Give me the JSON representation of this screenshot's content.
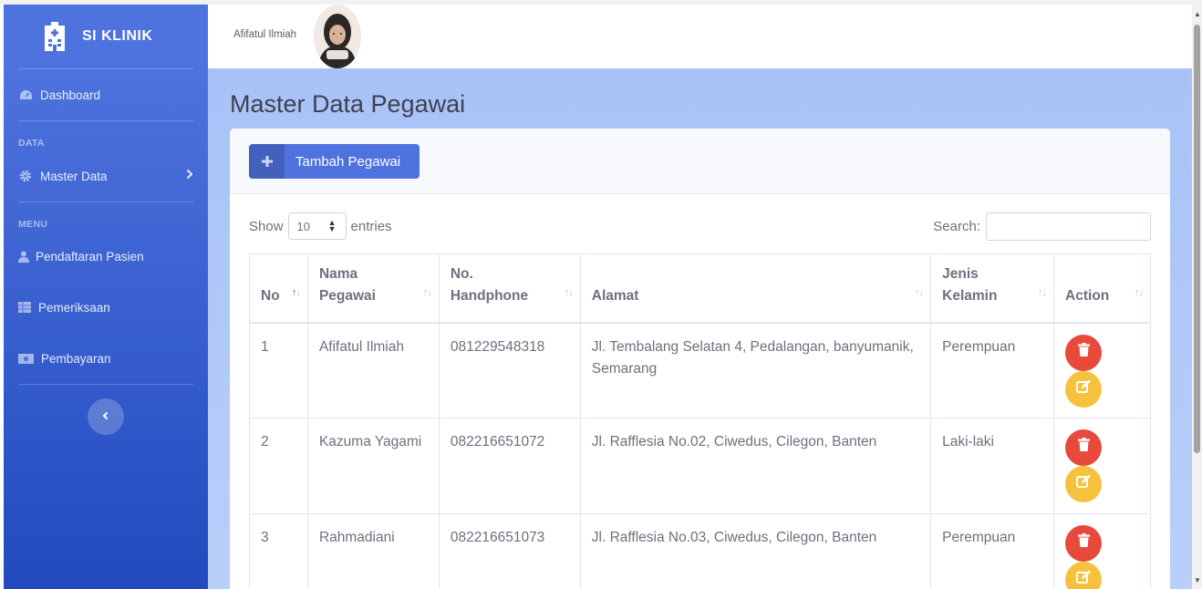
{
  "sidebar": {
    "brand": "SI KLINIK",
    "dashboard": "Dashboard",
    "heading_data": "DATA",
    "master_data": "Master Data",
    "heading_menu": "MENU",
    "pendaftaran": "Pendaftaran Pasien",
    "pemeriksaan": "Pemeriksaan",
    "pembayaran": "Pembayaran"
  },
  "topbar": {
    "user_name": "Afifatul Ilmiah"
  },
  "page": {
    "title": "Master Data Pegawai",
    "add_button": "Tambah Pegawai",
    "show_label": "Show",
    "entries_value": "10",
    "entries_label": "entries",
    "search_label": "Search:"
  },
  "table": {
    "headers": {
      "no": "No",
      "nama_1": "Nama",
      "nama_2": "Pegawai",
      "hp_1": "No.",
      "hp_2": "Handphone",
      "alamat": "Alamat",
      "jk_1": "Jenis",
      "jk_2": "Kelamin",
      "action": "Action"
    },
    "rows": [
      {
        "no": "1",
        "nama": "Afifatul Ilmiah",
        "hp": "081229548318",
        "alamat": "Jl. Tembalang Selatan 4, Pedalangan, banyumanik, Semarang",
        "jk": "Perempuan"
      },
      {
        "no": "2",
        "nama": "Kazuma Yagami",
        "hp": "082216651072",
        "alamat": "Jl. Rafflesia No.02, Ciwedus, Cilegon, Banten",
        "jk": "Laki-laki"
      },
      {
        "no": "3",
        "nama": "Rahmadiani",
        "hp": "082216651073",
        "alamat": "Jl. Rafflesia No.03, Ciwedus, Cilegon, Banten",
        "jk": "Perempuan"
      }
    ]
  },
  "icons": {
    "brand": "hospital-icon",
    "dashboard": "tachometer-icon",
    "master_data": "gear-icon",
    "pendaftaran": "user-icon",
    "pemeriksaan": "table-icon",
    "pembayaran": "money-icon",
    "delete": "trash-icon",
    "edit": "edit-icon"
  },
  "colors": {
    "primary": "#4e73df",
    "danger": "#e74a3b",
    "warning": "#f6c23e"
  }
}
